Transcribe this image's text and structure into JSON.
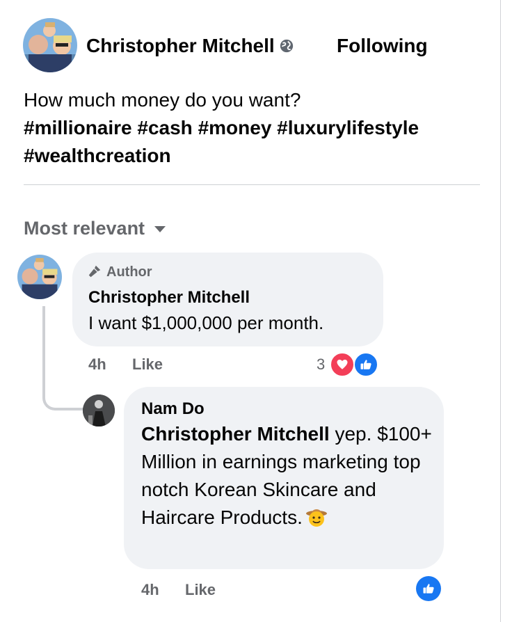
{
  "post": {
    "author": "Christopher Mitchell",
    "follow_label": "Following",
    "text": "How much money do you want?",
    "hashtags_line1": "#millionaire #cash #money #luxurylifestyle",
    "hashtags_line2": "#wealthcreation"
  },
  "comments_section": {
    "sort_label": "Most relevant"
  },
  "comment1": {
    "badge": "Author",
    "author": "Christopher Mitchell",
    "text": "I want $1,000,000 per month.",
    "time": "4h",
    "like_label": "Like",
    "reaction_count": "3"
  },
  "reply1": {
    "author": "Nam Do",
    "mention": "Christopher Mitchell",
    "text_line1": " yep.",
    "text_rest": "$100+ Million in earnings marketing top notch Korean Skincare and Haircare Products.",
    "time": "4h",
    "like_label": "Like"
  },
  "icons": {
    "globe": "globe-icon",
    "caret": "chevron-down-icon",
    "author_badge": "microphone-icon",
    "heart": "heart-reaction-icon",
    "like": "thumbs-up-reaction-icon",
    "emoji": "cowboy-emoji-icon"
  },
  "colors": {
    "bubble": "#f0f2f5",
    "secondary_text": "#65676b",
    "like_blue": "#1877f2",
    "heart_red": "#f33e58"
  }
}
